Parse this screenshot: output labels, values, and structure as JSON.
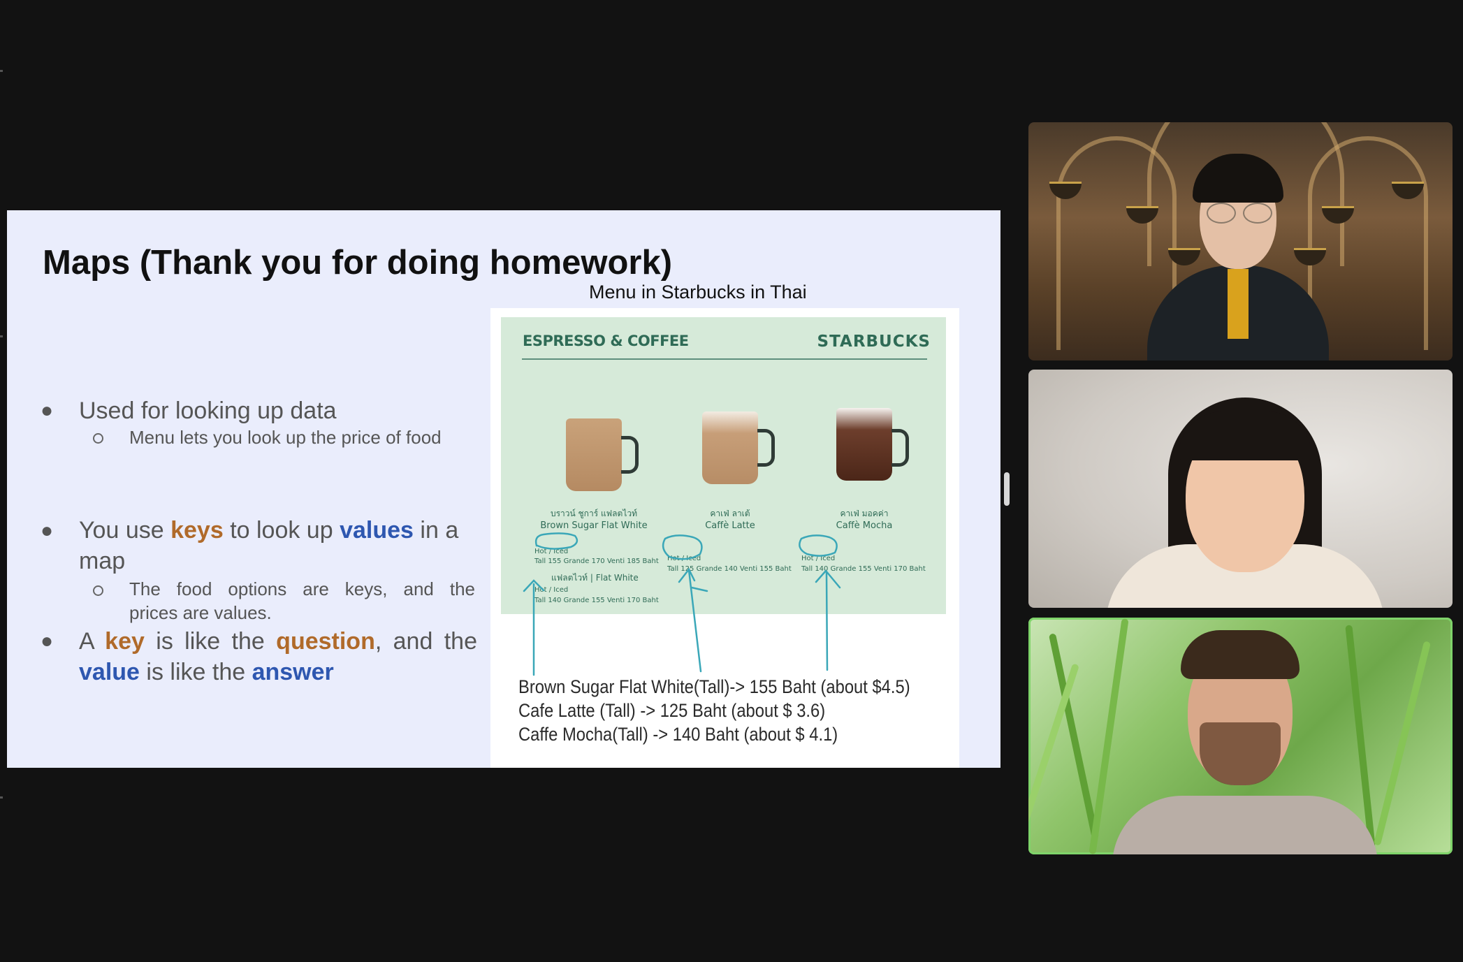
{
  "slide": {
    "title": "Maps (Thank you for doing homework)",
    "menu_caption": "Menu in Starbucks in Thai",
    "bullets": {
      "b1": "Used for looking up data",
      "b1_sub": "Menu lets you look up the price of food",
      "b2_pre": "You use",
      "b2_kw1": "keys",
      "b2_mid": "to look up",
      "b2_kw2": "values",
      "b2_post": "in a",
      "b2_line2": "map",
      "b2_sub_line1": "The food options are keys, and the",
      "b2_sub_line2": "prices are values.",
      "b3_pre": "A",
      "b3_kw1": "key",
      "b3_mid": "is like the",
      "b3_kw2": "question",
      "b3_post": ", and the",
      "b3_kw3": "value",
      "b3_mid2": "is like the",
      "b3_kw4": "answer"
    },
    "menu": {
      "header_left": "ESPRESSO & COFFEE",
      "header_right": "STARBUCKS",
      "drinks": [
        {
          "th": "บราวน์ ชูการ์ แฟลตไวท์",
          "en": "Brown Sugar Flat White",
          "price1": "Hot / Iced",
          "price2": "Tall 155  Grande 170  Venti 185 Baht"
        },
        {
          "th": "คาเฟ่ ลาเต้",
          "en": "Caffè Latte",
          "price1": "Hot / Iced",
          "price2": "Tall 125 Grande 140  Venti 155 Baht"
        },
        {
          "th": "คาเฟ่ มอคค่า",
          "en": "Caffè Mocha",
          "price1": "Hot / Iced",
          "price2": "Tall 140  Grande 155  Venti 170 Baht"
        }
      ],
      "flat_white_label": "แฟลตไวท์ | Flat White",
      "flat_white_price1": "Hot / Iced",
      "flat_white_price2": "Tall 140  Grande 155  Venti 170 Baht",
      "answers": [
        "Brown Sugar Flat White(Tall)-> 155 Baht (about $4.5)",
        "Cafe Latte (Tall) -> 125 Baht (about $ 3.6)",
        "Caffe Mocha(Tall) -> 140 Baht (about $ 4.1)"
      ]
    }
  },
  "participants": [
    {
      "tile": "participant-video-1",
      "active_speaker": false
    },
    {
      "tile": "participant-video-2",
      "active_speaker": false
    },
    {
      "tile": "participant-video-3",
      "active_speaker": true
    }
  ],
  "colors": {
    "key_highlight": "#b06a2a",
    "value_highlight": "#2e57b0",
    "active_speaker_border": "#7fd46a",
    "slide_bg": "#eaedfc"
  }
}
